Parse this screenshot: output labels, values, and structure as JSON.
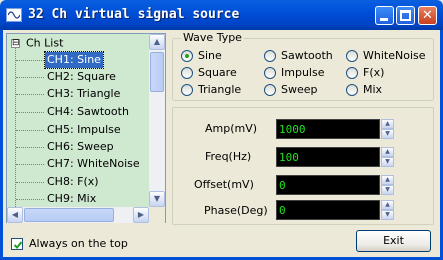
{
  "window": {
    "title": "32 Ch virtual signal source",
    "icons": {
      "app": "signal-app-icon",
      "minimize": "minimize-icon",
      "maximize": "maximize-icon",
      "close": "close-icon"
    },
    "close_glyph": "✕"
  },
  "tree": {
    "root_label": "Ch List",
    "expander": "⊟",
    "items": [
      {
        "label": "CH1: Sine"
      },
      {
        "label": "CH2: Square"
      },
      {
        "label": "CH3: Triangle"
      },
      {
        "label": "CH4: Sawtooth"
      },
      {
        "label": "CH5: Impulse"
      },
      {
        "label": "CH6: Sweep"
      },
      {
        "label": "CH7: WhiteNoise"
      },
      {
        "label": "CH8: F(x)"
      },
      {
        "label": "CH9: Mix"
      }
    ],
    "selected_index": 0,
    "highlight_color": "#316ac5",
    "background_color": "#cfe8d0"
  },
  "wave_type": {
    "title": "Wave Type",
    "options": [
      {
        "label": "Sine",
        "selected": true
      },
      {
        "label": "Sawtooth",
        "selected": false
      },
      {
        "label": "WhiteNoise",
        "selected": false
      },
      {
        "label": "Square",
        "selected": false
      },
      {
        "label": "Impulse",
        "selected": false
      },
      {
        "label": "F(x)",
        "selected": false
      },
      {
        "label": "Triangle",
        "selected": false
      },
      {
        "label": "Sweep",
        "selected": false
      },
      {
        "label": "Mix",
        "selected": false
      }
    ]
  },
  "params": {
    "amp": {
      "label": "Amp(mV)",
      "value": "1000"
    },
    "freq": {
      "label": "Freq(Hz)",
      "value": "100"
    },
    "offset": {
      "label": "Offset(mV)",
      "value": "0"
    },
    "phase": {
      "label": "Phase(Deg)",
      "value": "0"
    },
    "display_color": "#20e020"
  },
  "options": {
    "always_on_top": {
      "label": "Always on the top",
      "checked": true
    }
  },
  "buttons": {
    "exit": "Exit"
  }
}
